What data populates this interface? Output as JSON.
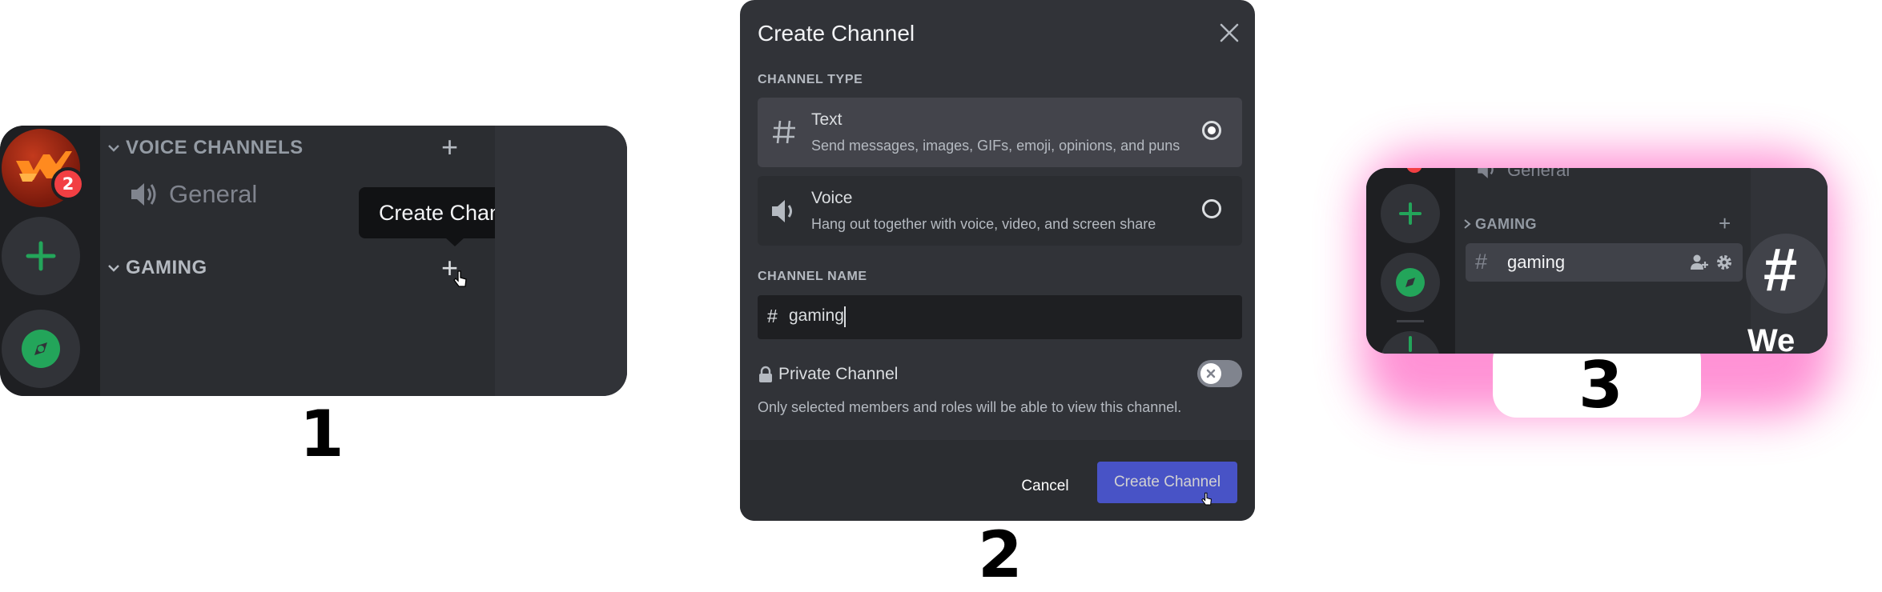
{
  "colors": {
    "discord_dark": "#1e1f22",
    "channel_bg": "#2b2d31",
    "modal_bg": "#313338",
    "blurple": "#5865f2",
    "green": "#23a55a",
    "badge_red": "#f23f43",
    "highlight_glow": "#ff6ec7"
  },
  "steps": [
    {
      "number": "1",
      "categories": [
        {
          "label": "VOICE CHANNELS",
          "channels": [
            {
              "name": "General",
              "icon": "speaker-icon"
            }
          ]
        },
        {
          "label": "GAMING",
          "channels": []
        }
      ],
      "server_badge": "2",
      "tooltip": "Create Channel"
    },
    {
      "number": "2",
      "modal": {
        "title": "Create Channel",
        "channel_type_label": "CHANNEL TYPE",
        "types": [
          {
            "label": "Text",
            "description": "Send messages, images, GIFs, emoji, opinions, and puns",
            "icon": "hash-icon",
            "selected": true
          },
          {
            "label": "Voice",
            "description": "Hang out together with voice, video, and screen share",
            "icon": "speaker-icon",
            "selected": false
          }
        ],
        "channel_name_label": "CHANNEL NAME",
        "channel_name_prefix": "#",
        "channel_name_value": "gaming",
        "private_label": "Private Channel",
        "private_enabled": false,
        "private_help": "Only selected members and roles will be able to view this channel.",
        "cancel": "Cancel",
        "create": "Create Channel"
      }
    },
    {
      "number": "3",
      "voice_channel": "General",
      "category": "GAMING",
      "channel": {
        "prefix": "#",
        "name": "gaming"
      },
      "cut_off_big_hash": "#",
      "cut_off_welcome": "We"
    }
  ]
}
